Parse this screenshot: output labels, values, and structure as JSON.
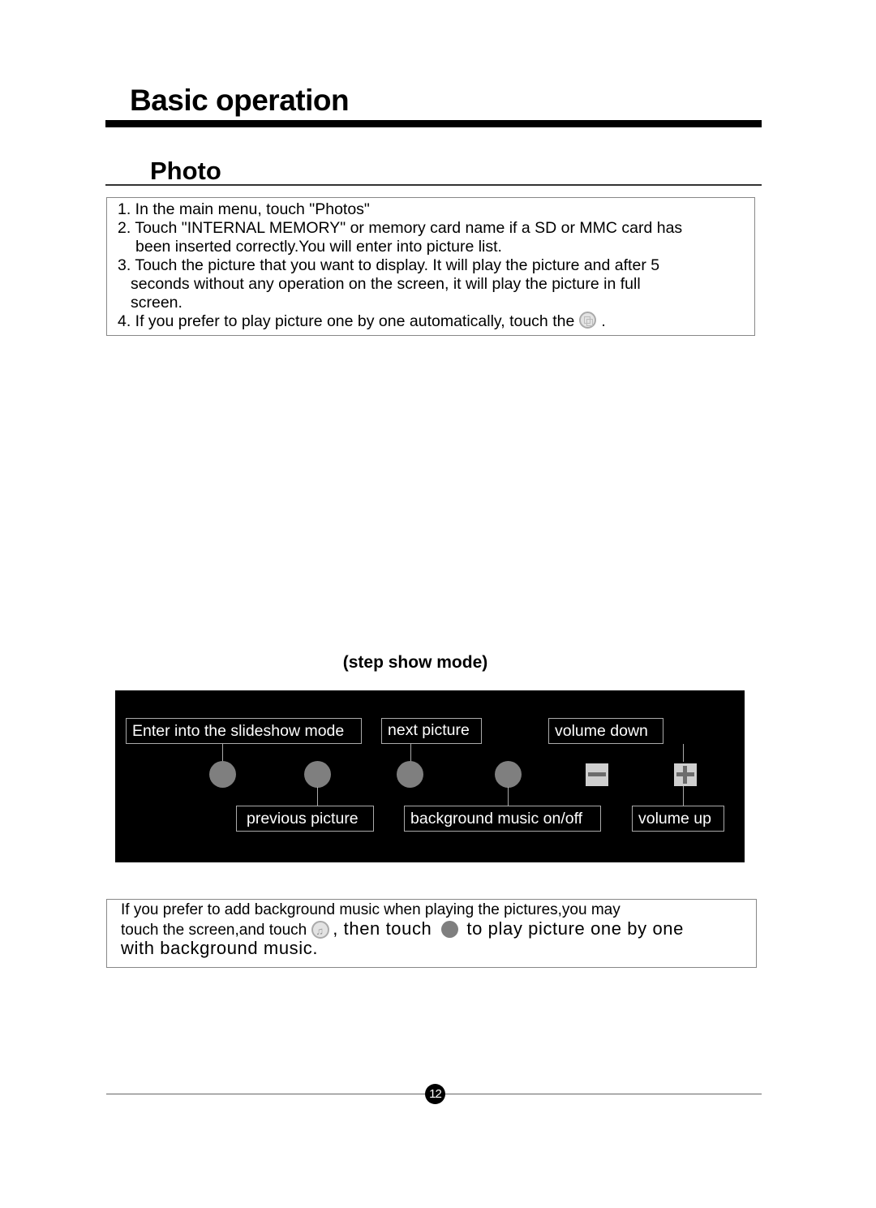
{
  "header": {
    "title": "Basic operation",
    "section": "Photo"
  },
  "instructions": {
    "lines": [
      "1. In the main menu, touch \"Photos\"",
      "2. Touch \"INTERNAL MEMORY\" or memory card name if a SD or MMC card has",
      "been inserted correctly.You will enter into picture list.",
      "3. Touch the picture that you want to display. It will play the picture and after 5",
      "seconds without any operation on the screen, it will play the picture in full",
      "screen.",
      "4. If you prefer to play picture one by one automatically, touch the",
      "."
    ],
    "inline_icon": "slideshow-icon"
  },
  "diagram": {
    "caption": "(step show mode)",
    "labels": {
      "slideshow": "Enter into the slideshow mode",
      "next": "next picture",
      "volume_down": "volume down",
      "previous": "previous picture",
      "music": "background music on/off",
      "volume_up": "volume up"
    },
    "icons": [
      "slideshow-button",
      "previous-button",
      "next-button",
      "music-toggle-button",
      "volume-down-button",
      "volume-up-button"
    ]
  },
  "note": {
    "line1": "If you prefer to add background music when playing the pictures,you may",
    "line2_a": "touch the screen,and touch",
    "line2_b": ",  then touch",
    "line2_c": "to play picture one by one",
    "line3": "with background music.",
    "icons": [
      "music-icon",
      "play-dot-icon"
    ]
  },
  "footer": {
    "page_number": "12"
  }
}
